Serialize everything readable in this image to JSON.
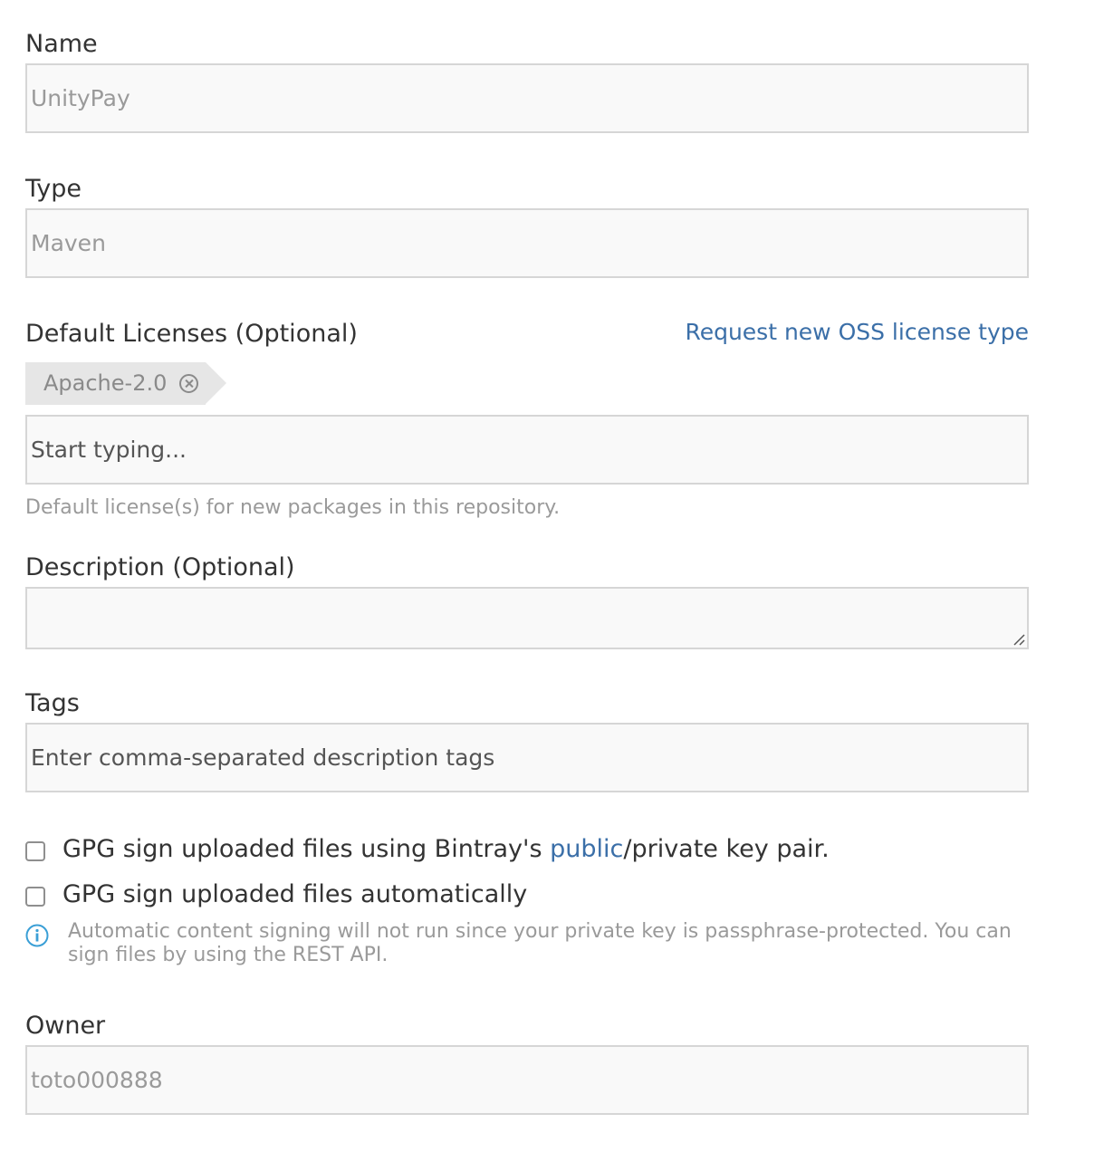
{
  "form": {
    "name": {
      "label": "Name",
      "value": "UnityPay"
    },
    "type": {
      "label": "Type",
      "value": "Maven"
    },
    "licenses": {
      "label": "Default Licenses (Optional)",
      "request_link": "Request new OSS license type",
      "tags": [
        {
          "label": "Apache-2.0",
          "remove_icon": "circle-x-icon"
        }
      ],
      "placeholder": "Start typing...",
      "help": "Default license(s) for new packages in this repository."
    },
    "description": {
      "label": "Description (Optional)",
      "value": ""
    },
    "tags": {
      "label": "Tags",
      "placeholder": "Enter comma-separated description tags"
    },
    "gpg_sign": {
      "text_before": "GPG sign uploaded files using Bintray's ",
      "link": "public",
      "text_after": "/private key pair.",
      "checked": false
    },
    "gpg_auto": {
      "label": "GPG sign uploaded files automatically",
      "checked": false
    },
    "info": {
      "icon": "info-icon",
      "text": "Automatic content signing will not run since your private key is passphrase-protected. You can sign files by using the REST API."
    },
    "owner": {
      "label": "Owner",
      "value": "toto000888"
    }
  },
  "colors": {
    "link": "#3b6fa8",
    "info_icon": "#3a9fd6",
    "field_bg": "#f9f9f9",
    "field_border": "#d6d6d6",
    "tag_bg": "#e6e6e6"
  }
}
